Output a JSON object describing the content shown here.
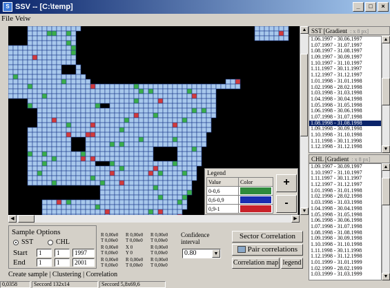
{
  "window": {
    "title": "SSV -- [C:\\temp]",
    "app_icon": "app-icon",
    "min_label": "_",
    "max_label": "□",
    "close_label": "×"
  },
  "menu": {
    "file_view": "File Veiw"
  },
  "map": {
    "ocean_color": "#a8c8ec",
    "land_color": "#000000",
    "grid_color": "#1e3c8c",
    "green_color": "#3cae4a",
    "red_color": "#d23a3a"
  },
  "legend": {
    "title": "Legend",
    "col_value": "Value",
    "col_color": "Color",
    "rows": [
      {
        "value": "0-0,6",
        "color": "#2f8a3c"
      },
      {
        "value": "0,6-0,9",
        "color": "#1a2db0"
      },
      {
        "value": "0,9-1",
        "color": "#c8222a"
      }
    ],
    "plus": "+",
    "minus": "-"
  },
  "sst": {
    "label": "SST",
    "gradient": "Gradient",
    "scale": ": x 8 px]",
    "items": [
      "1.06.1997 - 30.06.1997",
      "1.07.1997 - 31.07.1997",
      "1.08.1997 - 31.08.1997",
      "1.09.1997 - 30.09.1997",
      "1.10.1997 - 31.10.1997",
      "1.11.1997 - 30.11.1997",
      "1.12.1997 - 31.12.1997",
      "1.01.1998 - 31.01.1998",
      "1.02.1998 - 28.02.1998",
      "1.03.1998 - 31.03.1998",
      "1.04.1998 - 30.04.1998",
      "1.05.1998 - 31.05.1998",
      "1.06.1998 - 30.06.1998",
      "1.07.1998 - 31.07.1998",
      "1.08.1998 - 31.08.1998",
      "1.09.1998 - 30.09.1998",
      "1.10.1998 - 31.10.1998",
      "1.11.1998 - 30.11.1998",
      "1.12.1998 - 31.12.1998"
    ],
    "selected_index": 14
  },
  "chl": {
    "label": "CHL",
    "gradient": "Gradient",
    "scale": ": x 8 px]",
    "items": [
      "1.09.1997 - 30.09.1997",
      "1.10.1997 - 31.10.1997",
      "1.11.1997 - 30.11.1997",
      "1.12.1997 - 31.12.1997",
      "1.01.1998 - 31.01.1998",
      "1.02.1998 - 28.02.1998",
      "1.03.1998 - 31.03.1998",
      "1.04.1998 - 30.04.1998",
      "1.05.1998 - 31.05.1998",
      "1.06.1998 - 30.06.1998",
      "1.07.1998 - 31.07.1998",
      "1.08.1998 - 31.08.1998",
      "1.09.1998 - 30.09.1998",
      "1.10.1998 - 31.10.1998",
      "1.11.1998 - 30.11.1998",
      "1.12.1998 - 31.12.1998",
      "1.01.1999 - 31.01.1999",
      "1.02.1999 - 28.02.1999",
      "1.03.1999 - 31.03.1999"
    ]
  },
  "sample": {
    "title": "Sample Options",
    "sst_label": "SST",
    "chl_label": "CHL",
    "start_label": "Start",
    "end_label": "End",
    "start": {
      "d": "1",
      "m": "1",
      "y": "1997"
    },
    "end": {
      "d": "1",
      "m": "1",
      "y": "2001"
    }
  },
  "stats": {
    "r1": [
      [
        "R 0,00e0",
        "T 0,00e0"
      ],
      [
        "R 0,00e0",
        "T 0,00e0"
      ],
      [
        "R 0,00e0",
        "T 0,00e0"
      ]
    ],
    "r2": [
      [
        "R 0,00e0",
        "T 0,00e0"
      ],
      [
        "X 0",
        "Y 0"
      ],
      [
        "R 0,00e0",
        "T 0,00e0"
      ]
    ],
    "r3": [
      [
        "R 0,00e0",
        "T 0,00e0"
      ],
      [
        "R 0,00e0",
        "T 0,00e0"
      ],
      [
        "R 0,00e0",
        "T 0,00e0"
      ]
    ]
  },
  "confidence": {
    "label_1": "Confidence",
    "label_2": "interval",
    "value": "0.80"
  },
  "buttons": {
    "sector": "Sector Correlation",
    "pair": "Pair correlations",
    "map": "Correlation map",
    "legend": "legend"
  },
  "tabs": "Create sample | Clustering | Correlation",
  "status": {
    "s1": "0,0358",
    "s2": "Seccord 132x14",
    "s3": "Seccord 5,8x69,6"
  }
}
